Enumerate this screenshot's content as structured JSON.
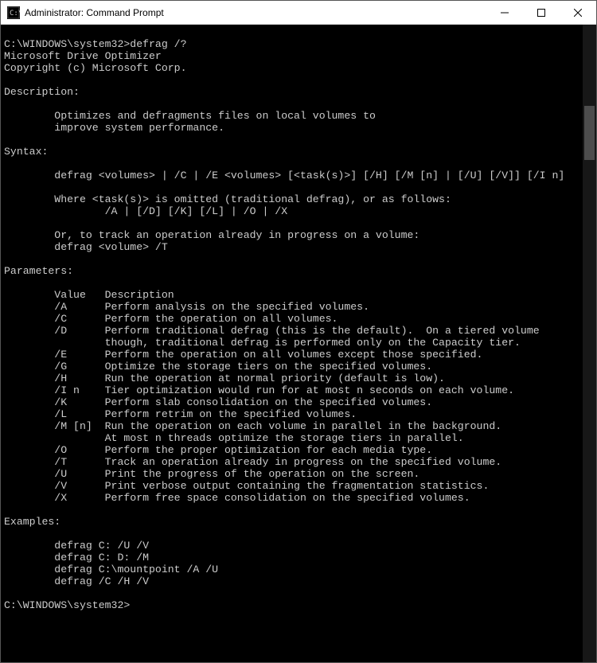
{
  "window": {
    "title": "Administrator: Command Prompt"
  },
  "prompt1": {
    "path": "C:\\WINDOWS\\system32>",
    "command": "defrag /?"
  },
  "output": {
    "line1": "Microsoft Drive Optimizer",
    "line2": "Copyright (c) Microsoft Corp."
  },
  "description": {
    "header": "Description:",
    "line1": "        Optimizes and defragments files on local volumes to",
    "line2": "        improve system performance."
  },
  "syntax": {
    "header": "Syntax:",
    "line1": "        defrag <volumes> | /C | /E <volumes> [<task(s)>] [/H] [/M [n] | [/U] [/V]] [/I n]",
    "line2": "        Where <task(s)> is omitted (traditional defrag), or as follows:",
    "line3": "                /A | [/D] [/K] [/L] | /O | /X",
    "line4": "        Or, to track an operation already in progress on a volume:",
    "line5": "        defrag <volume> /T"
  },
  "parameters": {
    "header": "Parameters:",
    "col_header": "        Value   Description",
    "rows": [
      "        /A      Perform analysis on the specified volumes.",
      "        /C      Perform the operation on all volumes.",
      "        /D      Perform traditional defrag (this is the default).  On a tiered volume",
      "                though, traditional defrag is performed only on the Capacity tier.",
      "        /E      Perform the operation on all volumes except those specified.",
      "        /G      Optimize the storage tiers on the specified volumes.",
      "        /H      Run the operation at normal priority (default is low).",
      "        /I n    Tier optimization would run for at most n seconds on each volume.",
      "        /K      Perform slab consolidation on the specified volumes.",
      "        /L      Perform retrim on the specified volumes.",
      "        /M [n]  Run the operation on each volume in parallel in the background.",
      "                At most n threads optimize the storage tiers in parallel.",
      "        /O      Perform the proper optimization for each media type.",
      "        /T      Track an operation already in progress on the specified volume.",
      "        /U      Print the progress of the operation on the screen.",
      "        /V      Print verbose output containing the fragmentation statistics.",
      "        /X      Perform free space consolidation on the specified volumes."
    ]
  },
  "examples": {
    "header": "Examples:",
    "lines": [
      "        defrag C: /U /V",
      "        defrag C: D: /M",
      "        defrag C:\\mountpoint /A /U",
      "        defrag /C /H /V"
    ]
  },
  "prompt2": {
    "path": "C:\\WINDOWS\\system32>"
  }
}
